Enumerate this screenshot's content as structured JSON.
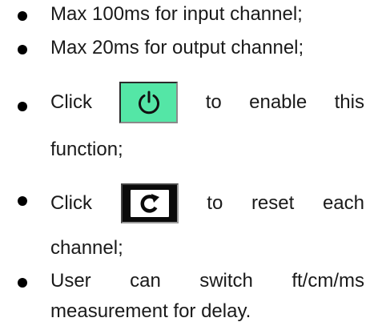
{
  "bullets": {
    "item1": "Max 100ms for input channel;",
    "item2": "Max 20ms for output channel;",
    "item3": {
      "word1": "Click",
      "word2": "to",
      "word3": "enable",
      "word4": "this",
      "line2": "function;"
    },
    "item4": {
      "word1": "Click",
      "word2": "to",
      "word3": "reset",
      "word4": "each",
      "line2": "channel;"
    },
    "item5": {
      "word1": "User",
      "word2": "can",
      "word3": "switch",
      "word4": "ft/cm/ms",
      "line2": "measurement for delay."
    }
  },
  "icons": {
    "power_button": {
      "icon": "power-icon",
      "background": "#54e6a6"
    },
    "reset_button": {
      "icon": "refresh-icon",
      "background": "#0a0a0a"
    }
  }
}
